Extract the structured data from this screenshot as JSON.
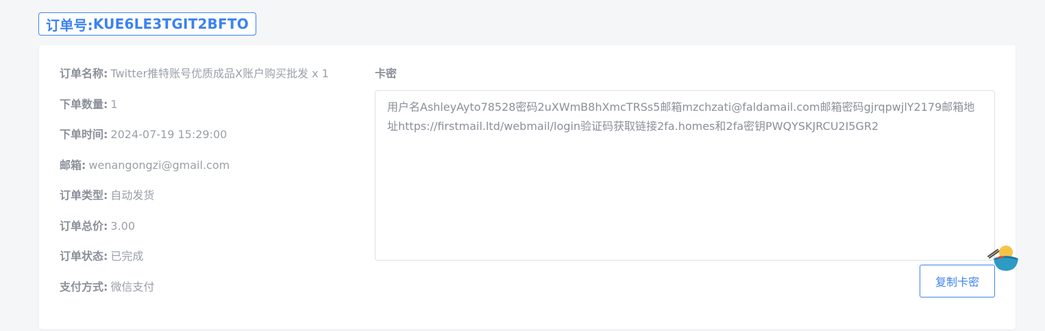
{
  "order_badge": {
    "label": "订单号:",
    "number": "KUE6LE3TGIT2BFTO"
  },
  "details": [
    {
      "label": "订单名称:",
      "value": "Twitter推特账号优质成品X账户购买批发 x 1"
    },
    {
      "label": "下单数量:",
      "value": "1"
    },
    {
      "label": "下单时间:",
      "value": "2024-07-19 15:29:00"
    },
    {
      "label": "邮箱:",
      "value": "wenangongzi@gmail.com"
    },
    {
      "label": "订单类型:",
      "value": "自动发货"
    },
    {
      "label": "订单总价:",
      "value": "3.00"
    },
    {
      "label": "订单状态:",
      "value": "已完成"
    },
    {
      "label": "支付方式:",
      "value": "微信支付"
    }
  ],
  "kami": {
    "title": "卡密",
    "content": "用户名AshleyAyto78528密码2uXWmB8hXmcTRSs5邮箱mzchzati@faldamail.com邮箱密码gjrqpwjlY2179邮箱地址https://firstmail.ltd/webmail/login验证码获取链接2fa.homes和2fa密钥PWQYSKJRCU2I5GR2"
  },
  "copy_button": {
    "label": "复制卡密"
  },
  "colors": {
    "accent": "#3c82f0",
    "label": "#8a8f99",
    "value": "#9a9fa8",
    "page_background": "#f5f6f8"
  },
  "icons": {
    "helper_widget": "bowl-mascot-icon"
  }
}
